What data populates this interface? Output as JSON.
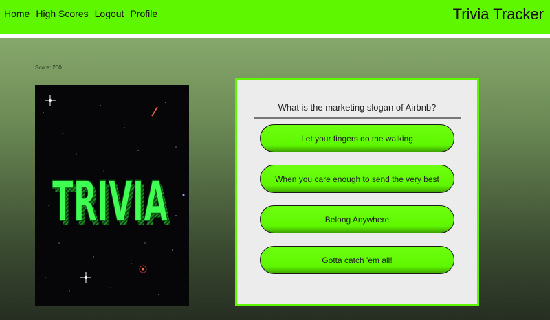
{
  "nav": {
    "links": [
      "Home",
      "High Scores",
      "Logout",
      "Profile"
    ],
    "brand": "Trivia Tracker"
  },
  "game": {
    "score": "Score: 200",
    "image_text": "TRIVIA",
    "question": "What is the marketing slogan of Airbnb?",
    "answers": [
      "Let your fingers do the walking",
      "When you care enough to send the very best",
      "Belong Anywhere",
      "Gotta catch 'em all!"
    ]
  },
  "colors": {
    "accent_green": "#5ff700",
    "card_background": "#ececec"
  }
}
